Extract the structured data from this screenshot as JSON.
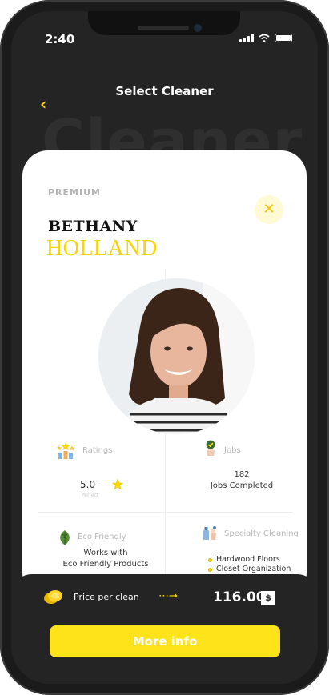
{
  "status_bar": {
    "time": "2:40"
  },
  "header": {
    "title": "Select Cleaner",
    "background_word": "Cleaner"
  },
  "cleaner": {
    "tier": "PREMIUM",
    "first_name": "BETHANY",
    "last_name": "HOLLAND"
  },
  "stats": {
    "ratings": {
      "label": "Ratings",
      "score": "5.0",
      "dash": "-",
      "caption": "Perfect"
    },
    "jobs": {
      "label": "Jobs",
      "count": "182",
      "caption": "Jobs Completed"
    },
    "eco": {
      "label": "Eco Friendly",
      "line1": "Works with",
      "line2": "Eco Friendly Products"
    },
    "specialty": {
      "label": "Specialty Cleaning",
      "items": [
        "Hardwood Floors",
        "Closet Organization"
      ]
    }
  },
  "pricing": {
    "label": "Price per clean",
    "value": "116.00",
    "currency_symbol": "$"
  },
  "actions": {
    "more_info": "More info"
  },
  "colors": {
    "accent": "#ffd800",
    "dark": "#242424"
  }
}
